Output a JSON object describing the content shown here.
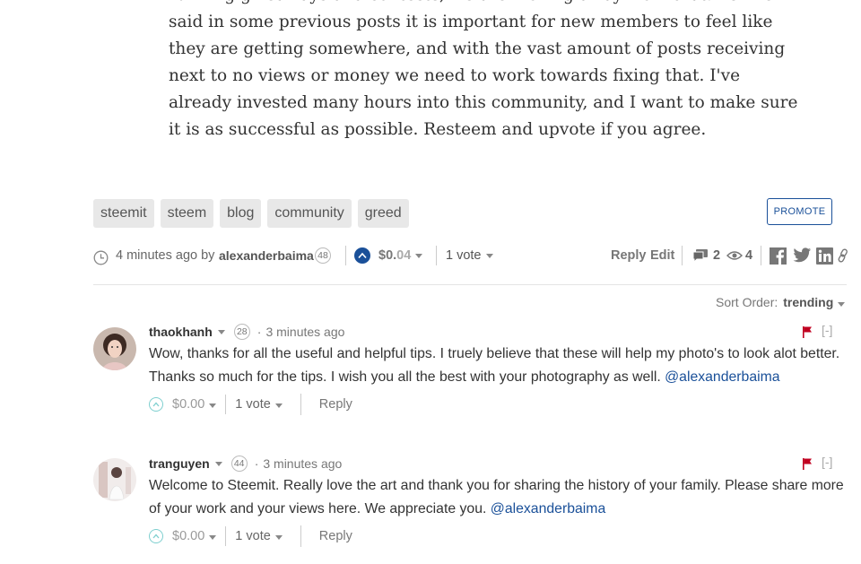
{
  "post": {
    "body_lines": [
      "running giveaways and contests, we are moving away from that. As I've",
      "said in some previous posts it is important for new members to feel like",
      "they are getting somewhere, and with the vast amount of posts receiving",
      "next to no views or money we need to work towards fixing that. I've",
      "already invested many hours into this community, and I want to make sure",
      "it is as successful as possible. Resteem and upvote if you agree."
    ],
    "tags": [
      "steemit",
      "steem",
      "blog",
      "community",
      "greed"
    ],
    "promote_label": "PROMOTE",
    "time_ago": "4 minutes ago by",
    "author": "alexanderbaima",
    "author_rep": "48",
    "payout_main": "$0.",
    "payout_decimals": "04",
    "votes": "1 vote",
    "reply_label": "Reply",
    "edit_label": "Edit",
    "comment_count": "2",
    "view_count": "4"
  },
  "sort": {
    "label": "Sort Order:",
    "value": "trending"
  },
  "comments": [
    {
      "author": "thaokhanh",
      "rep": "28",
      "time": "3 minutes ago",
      "body": "Wow, thanks for all the useful and helpful tips. I truely believe that these will help my photo's to look alot better. Thanks so much for the tips. I wish you all the best with your photography as well.",
      "mention": "@alexanderbaima",
      "payout": "$0.00",
      "votes": "1 vote",
      "reply_label": "Reply",
      "collapse_label": "[-]"
    },
    {
      "author": "tranguyen",
      "rep": "44",
      "time": "3 minutes ago",
      "body": "Welcome to Steemit. Really love the art and thank you for sharing the history of your family. Please share more of your work and your views here. We appreciate you.",
      "mention": "@alexanderbaima",
      "payout": "$0.00",
      "votes": "1 vote",
      "reply_label": "Reply",
      "collapse_label": "[-]"
    }
  ],
  "colors": {
    "link_blue": "#1a5099",
    "flag_red": "#c00020",
    "upvote_outline": "#7ecfcf"
  }
}
